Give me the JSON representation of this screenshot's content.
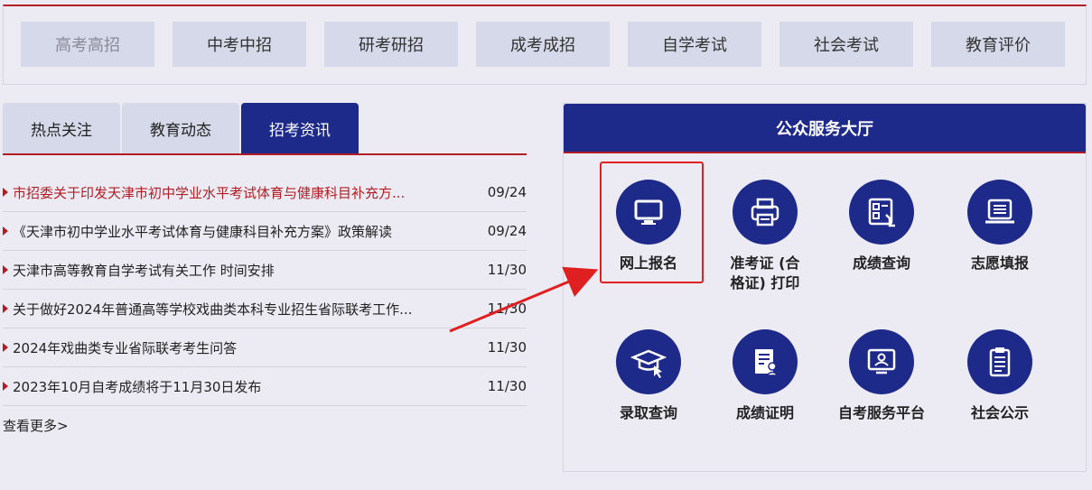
{
  "categories": [
    {
      "label": "高考高招",
      "muted": true
    },
    {
      "label": "中考中招"
    },
    {
      "label": "研考研招"
    },
    {
      "label": "成考成招"
    },
    {
      "label": "自学考试"
    },
    {
      "label": "社会考试"
    },
    {
      "label": "教育评价"
    }
  ],
  "tabs": [
    {
      "label": "热点关注"
    },
    {
      "label": "教育动态"
    },
    {
      "label": "招考资讯",
      "active": true
    }
  ],
  "news": [
    {
      "title": "市招委关于印发天津市初中学业水平考试体育与健康科目补充方...",
      "date": "09/24",
      "hot": true
    },
    {
      "title": "《天津市初中学业水平考试体育与健康科目补充方案》政策解读",
      "date": "09/24"
    },
    {
      "title": "天津市高等教育自学考试有关工作 时间安排",
      "date": "11/30"
    },
    {
      "title": "关于做好2024年普通高等学校戏曲类本科专业招生省际联考工作...",
      "date": "11/30"
    },
    {
      "title": "2024年戏曲类专业省际联考考生问答",
      "date": "11/30"
    },
    {
      "title": "2023年10月自考成绩将于11月30日发布",
      "date": "11/30"
    }
  ],
  "more_label": "查看更多>",
  "service": {
    "title": "公众服务大厅",
    "items": [
      {
        "label": "网上报名",
        "icon": "monitor-icon"
      },
      {
        "label": "准考证 (合格证) 打印",
        "icon": "printer-icon"
      },
      {
        "label": "成绩查询",
        "icon": "score-query-icon"
      },
      {
        "label": "志愿填报",
        "icon": "laptop-list-icon"
      },
      {
        "label": "录取查询",
        "icon": "graduation-cap-icon"
      },
      {
        "label": "成绩证明",
        "icon": "certificate-icon"
      },
      {
        "label": "自考服务平台",
        "icon": "screen-user-icon"
      },
      {
        "label": "社会公示",
        "icon": "clipboard-icon"
      }
    ]
  },
  "colors": {
    "accent": "#1e2a8a",
    "red": "#b21d23",
    "tab_bg": "#d6d9e9",
    "page_bg": "#ecebf3"
  }
}
